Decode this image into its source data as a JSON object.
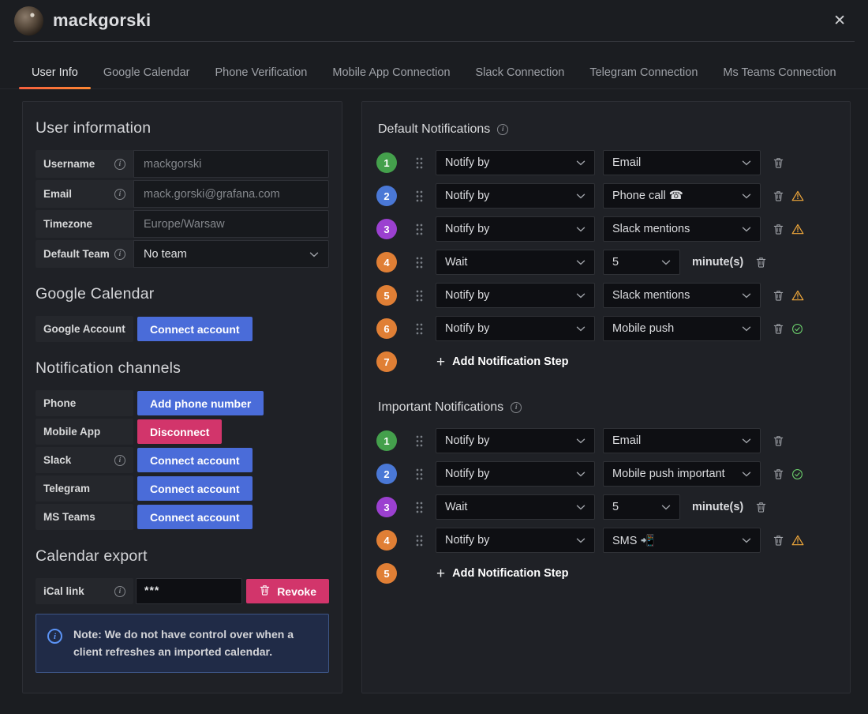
{
  "header": {
    "title": "mackgorski",
    "close_icon": "✕"
  },
  "tabs": {
    "items": [
      {
        "label": "User Info",
        "active": true
      },
      {
        "label": "Google Calendar",
        "active": false
      },
      {
        "label": "Phone Verification",
        "active": false
      },
      {
        "label": "Mobile App Connection",
        "active": false
      },
      {
        "label": "Slack Connection",
        "active": false
      },
      {
        "label": "Telegram Connection",
        "active": false
      },
      {
        "label": "Ms Teams Connection",
        "active": false
      }
    ]
  },
  "user_info": {
    "heading": "User information",
    "fields": [
      {
        "label": "Username",
        "info": true,
        "value": "mackgorski",
        "type": "input"
      },
      {
        "label": "Email",
        "info": true,
        "value": "mack.gorski@grafana.com",
        "type": "input"
      },
      {
        "label": "Timezone",
        "info": false,
        "value": "Europe/Warsaw",
        "type": "input"
      },
      {
        "label": "Default Team",
        "info": true,
        "value": "No team",
        "type": "select"
      }
    ]
  },
  "google_calendar": {
    "heading": "Google Calendar",
    "label": "Google Account",
    "button_label": "Connect account"
  },
  "notification_channels": {
    "heading": "Notification channels",
    "rows": [
      {
        "label": "Phone",
        "info": false,
        "button_label": "Add phone number",
        "variant": "primary"
      },
      {
        "label": "Mobile App",
        "info": false,
        "button_label": "Disconnect",
        "variant": "destructive"
      },
      {
        "label": "Slack",
        "info": true,
        "button_label": "Connect account",
        "variant": "primary"
      },
      {
        "label": "Telegram",
        "info": false,
        "button_label": "Connect account",
        "variant": "primary"
      },
      {
        "label": "MS Teams",
        "info": false,
        "button_label": "Connect account",
        "variant": "primary"
      }
    ]
  },
  "calendar_export": {
    "heading": "Calendar export",
    "label": "iCal link",
    "value": "***",
    "revoke_label": "Revoke",
    "note": "Note: We do not have control over when a client refreshes an imported calendar."
  },
  "notification_policies": {
    "default": {
      "heading": "Default Notifications",
      "steps": [
        {
          "num": 1,
          "color": "green",
          "type": "pair",
          "first": "Notify by",
          "second": "Email",
          "status": null
        },
        {
          "num": 2,
          "color": "blue",
          "type": "pair",
          "first": "Notify by",
          "second": "Phone call ☎",
          "status": "warning"
        },
        {
          "num": 3,
          "color": "purple",
          "type": "pair",
          "first": "Notify by",
          "second": "Slack mentions",
          "status": "warning"
        },
        {
          "num": 4,
          "color": "orange",
          "type": "wait",
          "first": "Wait",
          "second": "5",
          "suffix": "minute(s)",
          "status": null
        },
        {
          "num": 5,
          "color": "orange",
          "type": "pair",
          "first": "Notify by",
          "second": "Slack mentions",
          "status": "warning"
        },
        {
          "num": 6,
          "color": "orange",
          "type": "pair",
          "first": "Notify by",
          "second": "Mobile push",
          "status": "ok"
        },
        {
          "num": 7,
          "color": "orange",
          "type": "add",
          "label": "Add Notification Step"
        }
      ]
    },
    "important": {
      "heading": "Important Notifications",
      "steps": [
        {
          "num": 1,
          "color": "green",
          "type": "pair",
          "first": "Notify by",
          "second": "Email",
          "status": null
        },
        {
          "num": 2,
          "color": "blue",
          "type": "pair",
          "first": "Notify by",
          "second": "Mobile push important",
          "status": "ok"
        },
        {
          "num": 3,
          "color": "purple",
          "type": "wait",
          "first": "Wait",
          "second": "5",
          "suffix": "minute(s)",
          "status": null
        },
        {
          "num": 4,
          "color": "orange",
          "type": "pair",
          "first": "Notify by",
          "second": "SMS 📲",
          "status": "warning"
        },
        {
          "num": 5,
          "color": "orange",
          "type": "add",
          "label": "Add Notification Step"
        }
      ]
    }
  },
  "colors": {
    "accent_orange_start": "#f55f3e",
    "accent_orange_end": "#ff8833",
    "primary_blue": "#4a6cd9",
    "destructive_red": "#d2356b",
    "step_green": "#44a04c",
    "step_blue": "#4a78d6",
    "step_purple": "#9b40d0",
    "step_orange": "#e07f35",
    "warning": "#f2a93b",
    "success": "#6ccf6c"
  }
}
